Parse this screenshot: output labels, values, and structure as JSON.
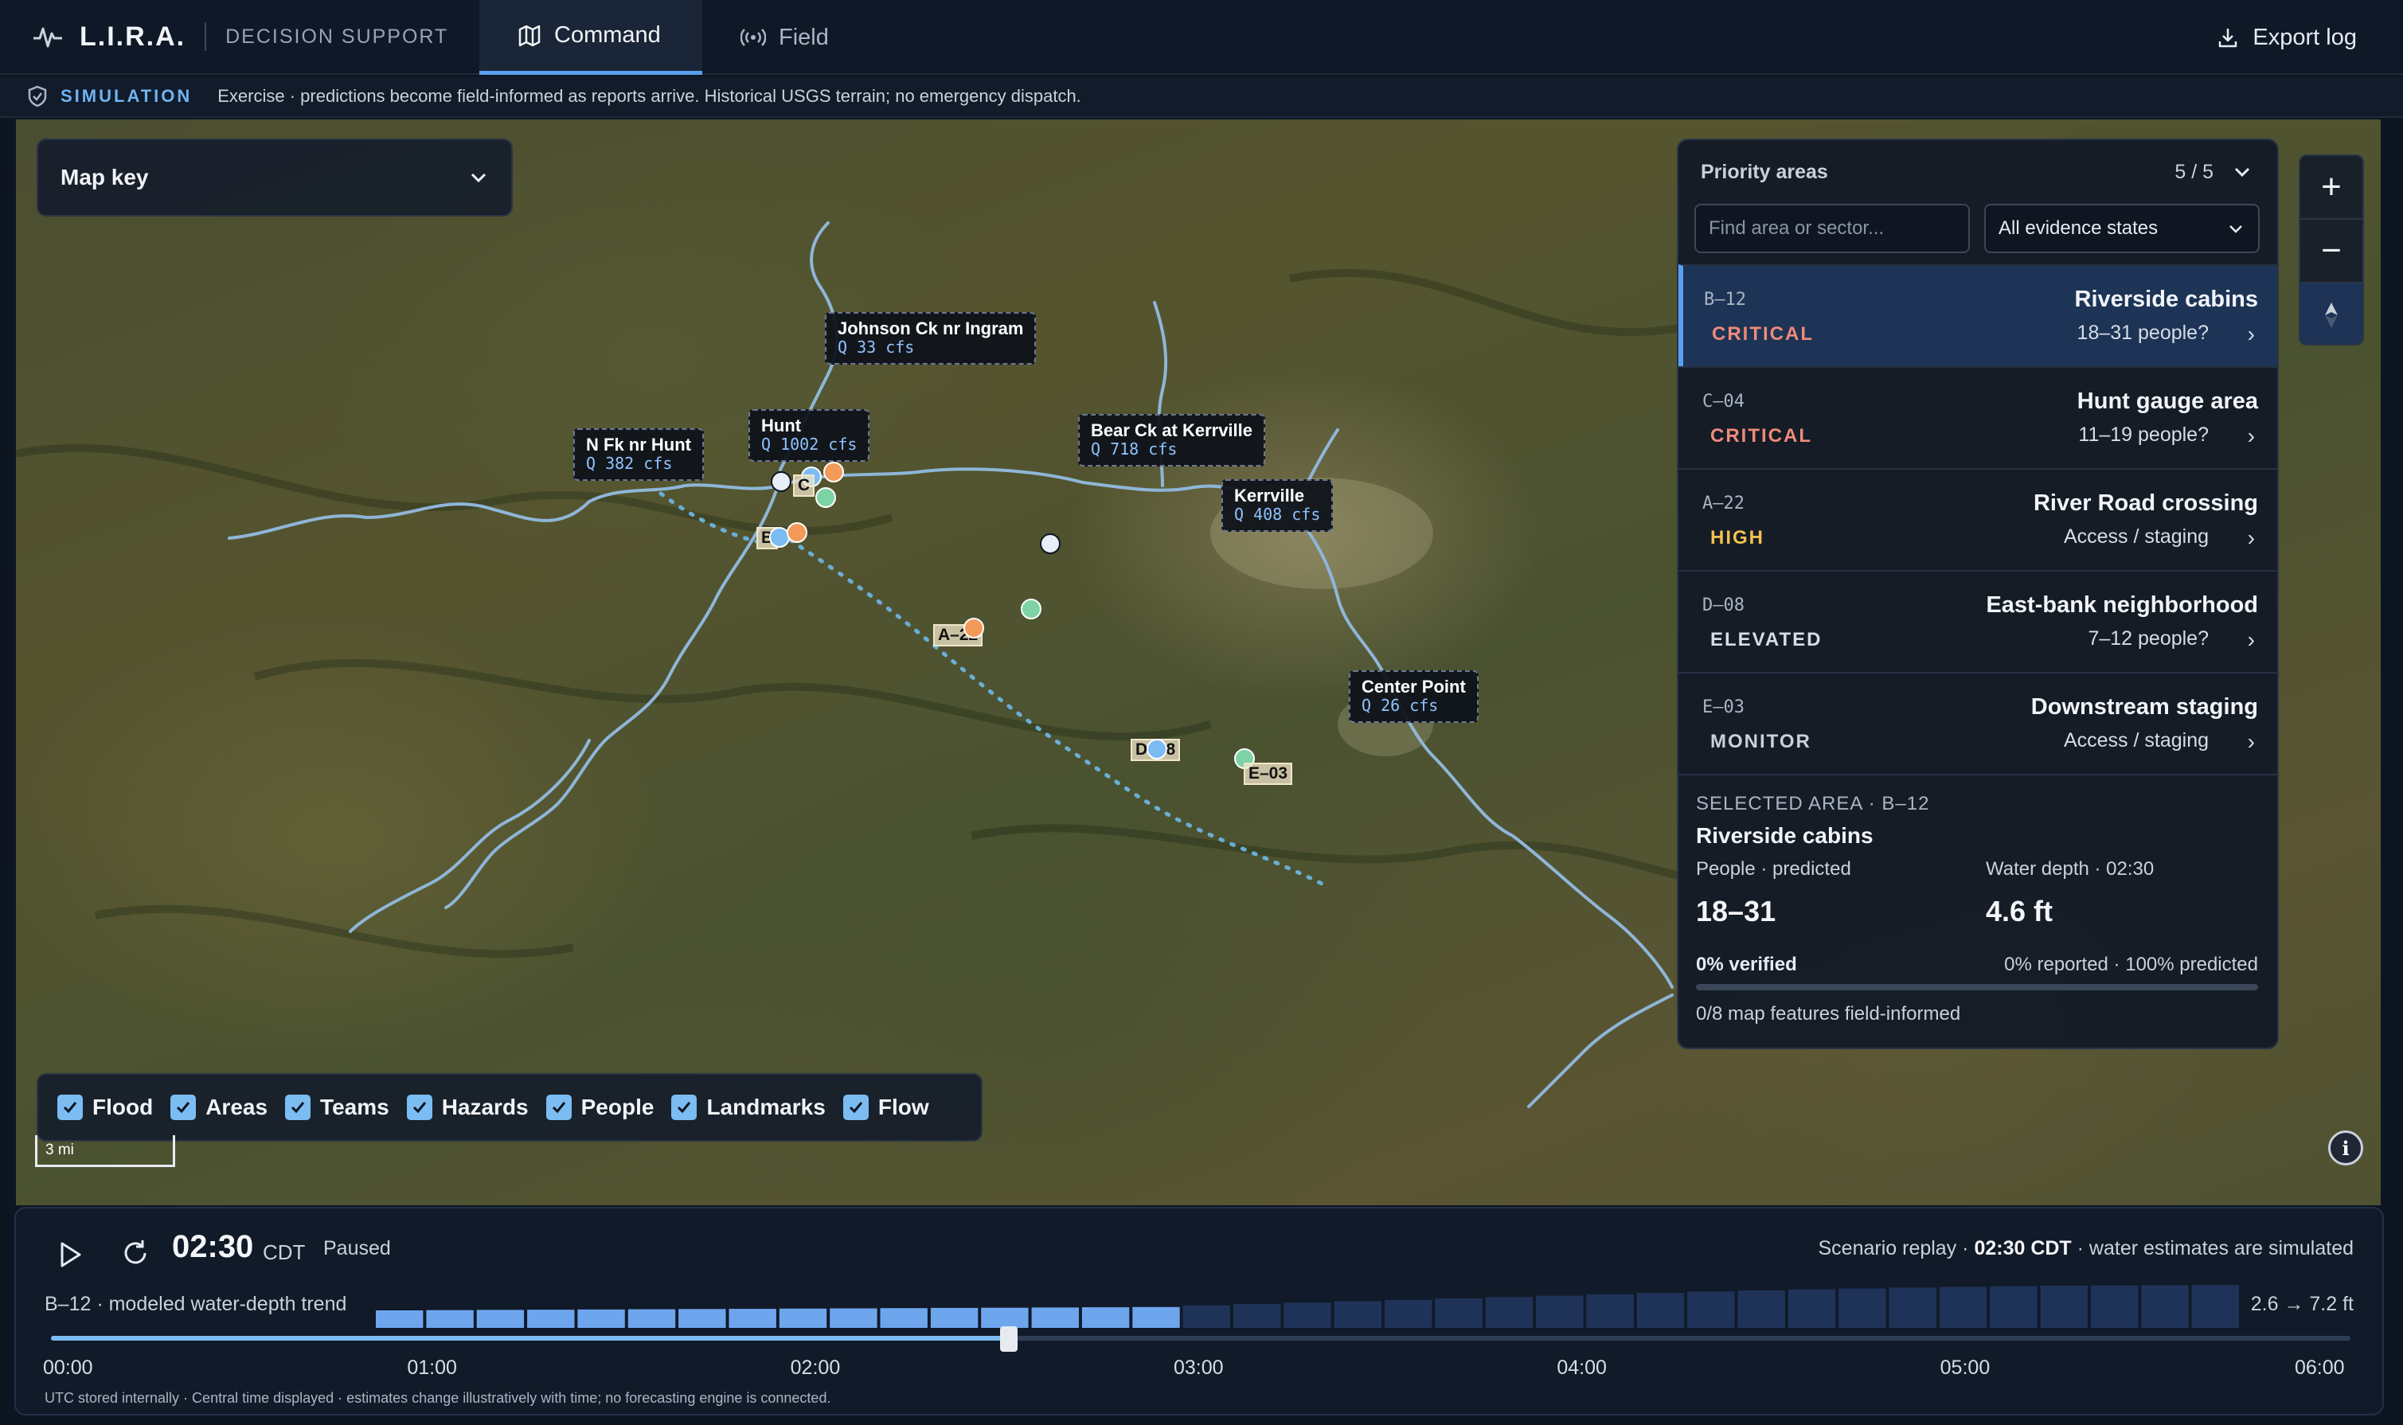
{
  "header": {
    "brand_name": "L.I.R.A.",
    "brand_sub": "DECISION SUPPORT",
    "tabs": [
      {
        "label": "Command",
        "icon": "map-icon",
        "active": true
      },
      {
        "label": "Field",
        "icon": "broadcast-icon",
        "active": false
      }
    ],
    "export_label": "Export log"
  },
  "banner": {
    "tag": "SIMULATION",
    "text": "Exercise · predictions become field-informed as reports arrive. Historical USGS terrain; no emergency dispatch."
  },
  "map": {
    "map_key_label": "Map key",
    "gauges": [
      {
        "name": "Johnson Ck nr Ingram",
        "q": "Q 33 cfs"
      },
      {
        "name": "N Fk nr Hunt",
        "q": "Q 382 cfs"
      },
      {
        "name": "Hunt",
        "q": "Q 1002 cfs"
      },
      {
        "name": "Bear Ck at Kerrville",
        "q": "Q 718 cfs"
      },
      {
        "name": "Kerrville",
        "q": "Q 408 cfs"
      },
      {
        "name": "Center Point",
        "q": "Q 26 cfs"
      }
    ],
    "area_tags": [
      "B",
      "C",
      "A–22",
      "D–08",
      "E–03"
    ],
    "layers": [
      "Flood",
      "Areas",
      "Teams",
      "Hazards",
      "People",
      "Landmarks",
      "Flow"
    ],
    "scale_label": "3 mi",
    "zoom_in": "+",
    "zoom_out": "−"
  },
  "panel": {
    "title": "Priority areas",
    "count": "5 / 5",
    "search_placeholder": "Find area or sector...",
    "evidence_filter": "All evidence states",
    "areas": [
      {
        "id": "B–12",
        "severity": "CRITICAL",
        "name": "Riverside cabins",
        "sub": "18–31 people?",
        "selected": true
      },
      {
        "id": "C–04",
        "severity": "CRITICAL",
        "name": "Hunt gauge area",
        "sub": "11–19 people?",
        "selected": false
      },
      {
        "id": "A–22",
        "severity": "HIGH",
        "name": "River Road crossing",
        "sub": "Access / staging",
        "selected": false
      },
      {
        "id": "D–08",
        "severity": "ELEVATED",
        "name": "East-bank neighborhood",
        "sub": "7–12 people?",
        "selected": false
      },
      {
        "id": "E–03",
        "severity": "MONITOR",
        "name": "Downstream staging",
        "sub": "Access / staging",
        "selected": false
      }
    ],
    "severity_colors": {
      "CRITICAL": "#f08a7a",
      "HIGH": "#f2c14e",
      "ELEVATED": "#d6dde6",
      "MONITOR": "#c8d1dc"
    },
    "selected_area": {
      "caption": "SELECTED AREA · B–12",
      "name": "Riverside cabins",
      "people_label": "People · predicted",
      "people_value": "18–31",
      "depth_label": "Water depth · 02:30",
      "depth_value": "4.6 ft",
      "verified": "0% verified",
      "reported": "0% reported · 100% predicted",
      "verified_fraction": 0,
      "features": "0/8 map features field-informed"
    }
  },
  "timeline": {
    "time": "02:30",
    "zone": "CDT",
    "state": "Paused",
    "scenario_prefix": "Scenario replay · ",
    "scenario_time": "02:30 CDT",
    "scenario_suffix": " · water estimates are simulated",
    "trend_label": "B–12 · modeled water-depth trend",
    "trend_range": "2.6 → 7.2 ft",
    "trend_depths_ft": [
      2.6,
      2.64,
      2.68,
      2.72,
      2.76,
      2.8,
      2.84,
      2.88,
      2.92,
      2.96,
      3.0,
      3.04,
      3.08,
      3.12,
      3.16,
      3.2,
      3.5,
      3.75,
      4.0,
      4.25,
      4.5,
      4.75,
      5.0,
      5.25,
      5.5,
      5.75,
      6.0,
      6.2,
      6.4,
      6.55,
      6.7,
      6.85,
      6.95,
      7.05,
      7.1,
      7.15,
      7.2
    ],
    "elapsed_steps": 16,
    "ticks": [
      "00:00",
      "01:00",
      "02:00",
      "03:00",
      "04:00",
      "05:00",
      "06:00"
    ],
    "progress": 0.4167,
    "footnote": "UTC stored internally · Central time displayed · estimates change illustratively with time; no forecasting engine is connected.",
    "colors": {
      "elapsed": "#6ea6ee",
      "future": "#1f3358"
    }
  }
}
